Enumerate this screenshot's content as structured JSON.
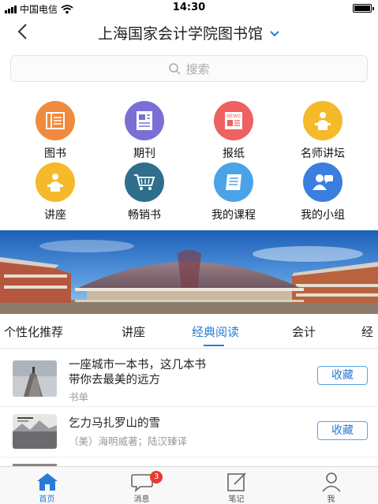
{
  "status_bar": {
    "carrier": "中国电信",
    "time": "14:30"
  },
  "nav": {
    "title": "上海国家会计学院图书馆"
  },
  "search": {
    "placeholder": "搜索"
  },
  "grid": [
    {
      "label": "图书",
      "icon": "book-icon",
      "color": "#f08a3c"
    },
    {
      "label": "期刊",
      "icon": "journal-icon",
      "color": "#7b6fd6"
    },
    {
      "label": "报纸",
      "icon": "newspaper-icon",
      "color": "#ef6060"
    },
    {
      "label": "名师讲坛",
      "icon": "lecturer-podium-icon",
      "color": "#f5b92a"
    },
    {
      "label": "讲座",
      "icon": "lecture-podium-icon",
      "color": "#f5b92a"
    },
    {
      "label": "畅销书",
      "icon": "shopping-cart-icon",
      "color": "#2f6e8c"
    },
    {
      "label": "我的课程",
      "icon": "course-icon",
      "color": "#4aa3e8"
    },
    {
      "label": "我的小组",
      "icon": "group-icon",
      "color": "#3a7ee0"
    }
  ],
  "tabs": [
    "个性化推荐",
    "讲座",
    "经典阅读",
    "会计",
    "经"
  ],
  "active_tab": "经典阅读",
  "list": [
    {
      "title_line1": "一座城市一本书，这几本书",
      "title_line2": "带你去最美的远方",
      "subtitle": "书单",
      "button": "收藏"
    },
    {
      "title_line1": "乞力马扎罗山的雪",
      "subtitle": "（美）海明威著；陆汉臻译",
      "button": "收藏"
    }
  ],
  "tab_bar": [
    {
      "label": "首页",
      "icon": "home-icon"
    },
    {
      "label": "消息",
      "icon": "message-icon",
      "badge": "3"
    },
    {
      "label": "笔记",
      "icon": "note-icon"
    },
    {
      "label": "我",
      "icon": "profile-icon"
    }
  ],
  "colors": {
    "accent": "#2a7bd8",
    "badge": "#e83a2f"
  }
}
